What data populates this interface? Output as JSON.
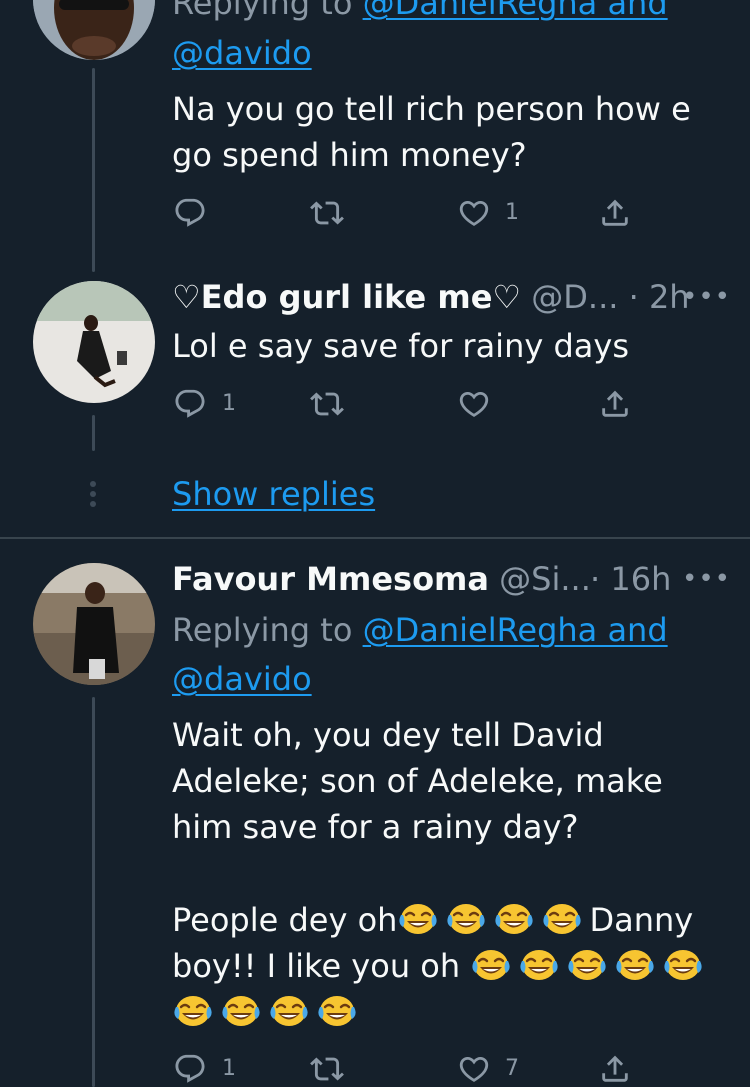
{
  "tweet1": {
    "replying_prefix": "Replying to",
    "replying_handles_line1": "@DanielRegha and",
    "replying_handles_line2": "@davido",
    "text_line1": "Na you go tell rich person how e",
    "text_line2": "go spend him money?",
    "reply_count": "",
    "retweet_count": "",
    "like_count": "1"
  },
  "tweet2": {
    "display_name": "♡Edo gurl like me♡",
    "handle": "@D...",
    "time": "· 2h",
    "text": "Lol e say save for rainy days",
    "reply_count": "1",
    "retweet_count": "",
    "like_count": ""
  },
  "show_replies": "Show replies",
  "tweet3": {
    "display_name": "Favour Mmesoma",
    "handle": "@Si...",
    "time": "· 16h",
    "replying_prefix": "Replying to",
    "replying_handles_line1": "@DanielRegha and",
    "replying_handles_line2": "@davido",
    "text_line1": "Wait oh, you dey tell David",
    "text_line2": "Adeleke; son of Adeleke, make",
    "text_line3": "him save for a rainy day?",
    "text_line4": "People dey oh",
    "text_line4_end": "Danny",
    "text_line5": "boy!! I like you oh",
    "reply_count": "1",
    "retweet_count": "",
    "like_count": "7"
  },
  "icons": {
    "reply": "reply-icon",
    "retweet": "retweet-icon",
    "like": "heart-icon",
    "share": "share-icon",
    "more": "more-icon",
    "emoji": "face-with-tears-of-joy-emoji"
  },
  "colors": {
    "background": "#15202b",
    "link": "#1d9bf0",
    "muted": "#8b98a5"
  }
}
